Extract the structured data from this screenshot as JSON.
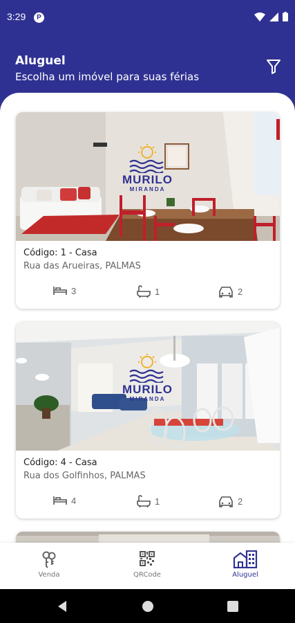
{
  "status_bar": {
    "time": "3:29",
    "app_badge": "P"
  },
  "header": {
    "title": "Aluguel",
    "subtitle": "Escolha um imóvel para suas férias"
  },
  "logo": {
    "line1": "MURILO",
    "line2": "MIRANDA"
  },
  "listings": [
    {
      "code": "Código: 1 - Casa",
      "address": "Rua das Arueiras, PALMAS",
      "bedrooms": "3",
      "bathrooms": "1",
      "garages": "2"
    },
    {
      "code": "Código: 4 - Casa",
      "address": "Rua dos Golfinhos, PALMAS",
      "bedrooms": "4",
      "bathrooms": "1",
      "garages": "2"
    }
  ],
  "bottom_nav": [
    {
      "label": "Venda",
      "icon": "keys-icon",
      "active": false
    },
    {
      "label": "QRCode",
      "icon": "qrcode-icon",
      "active": false
    },
    {
      "label": "Aluguel",
      "icon": "buildings-icon",
      "active": true
    }
  ],
  "colors": {
    "primary": "#2f3192",
    "accent_logo": "#f2b233",
    "background": "#ffffff"
  }
}
